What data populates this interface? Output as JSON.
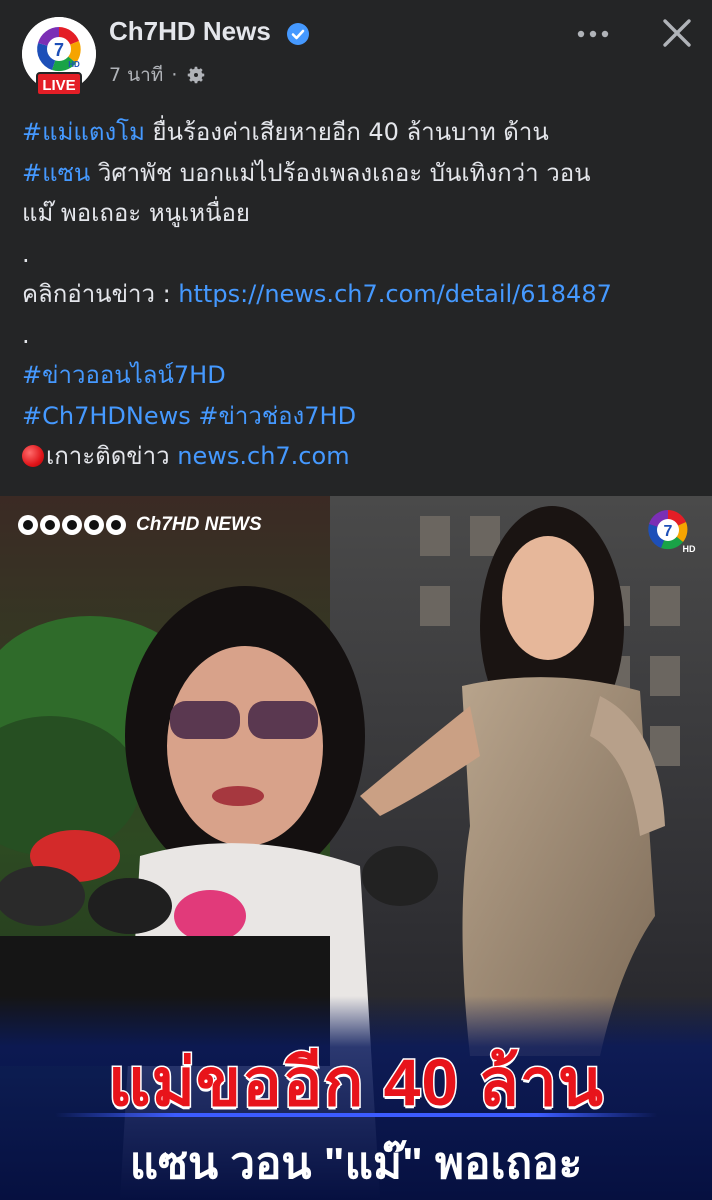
{
  "header": {
    "page_name": "Ch7HD News",
    "live_label": "LIVE",
    "time_ago": "7 นาที",
    "separator": "·",
    "icons": {
      "avatar": "ch7-logo",
      "verified": "verified-badge-icon",
      "audience": "gear-icon",
      "more": "more-dots-icon",
      "close": "close-icon"
    }
  },
  "post": {
    "line1_hashtag": "#แม่แตงโม",
    "line1_text": " ยื่นร้องค่าเสียหายอีก 40 ล้านบาท ด้าน",
    "line2_hashtag": "#แซน",
    "line2_text": " วิศาพัช บอกแม่ไปร้องเพลงเถอะ บันเทิงกว่า วอน",
    "line3_text": "แม๊  พอเถอะ หนูเหนื่อย",
    "dot1": ".",
    "read_label": "คลิกอ่านข่าว : ",
    "read_link": "https://news.ch7.com/detail/618487",
    "dot2": ".",
    "tag_online": "#ข่าวออนไลน์7HD",
    "tag_news": "#Ch7HDNews",
    "tag_channel": "#ข่าวช่อง7HD",
    "follow_label": "เกาะติดข่าว ",
    "follow_link": "news.ch7.com"
  },
  "image": {
    "brand_text": "Ch7HD NEWS",
    "headline": "แม่ขออีก 40 ล้าน",
    "subheadline": "แซน วอน \"แม๊\" พอเถอะ",
    "colors": {
      "headline": "#e8141b",
      "banner": "#0a1a5c",
      "divider": "#3c5cff"
    }
  },
  "colors": {
    "background": "#242526",
    "text": "#e4e6eb",
    "link": "#4599ff",
    "muted": "#b0b3b8",
    "live": "#e41e26"
  }
}
